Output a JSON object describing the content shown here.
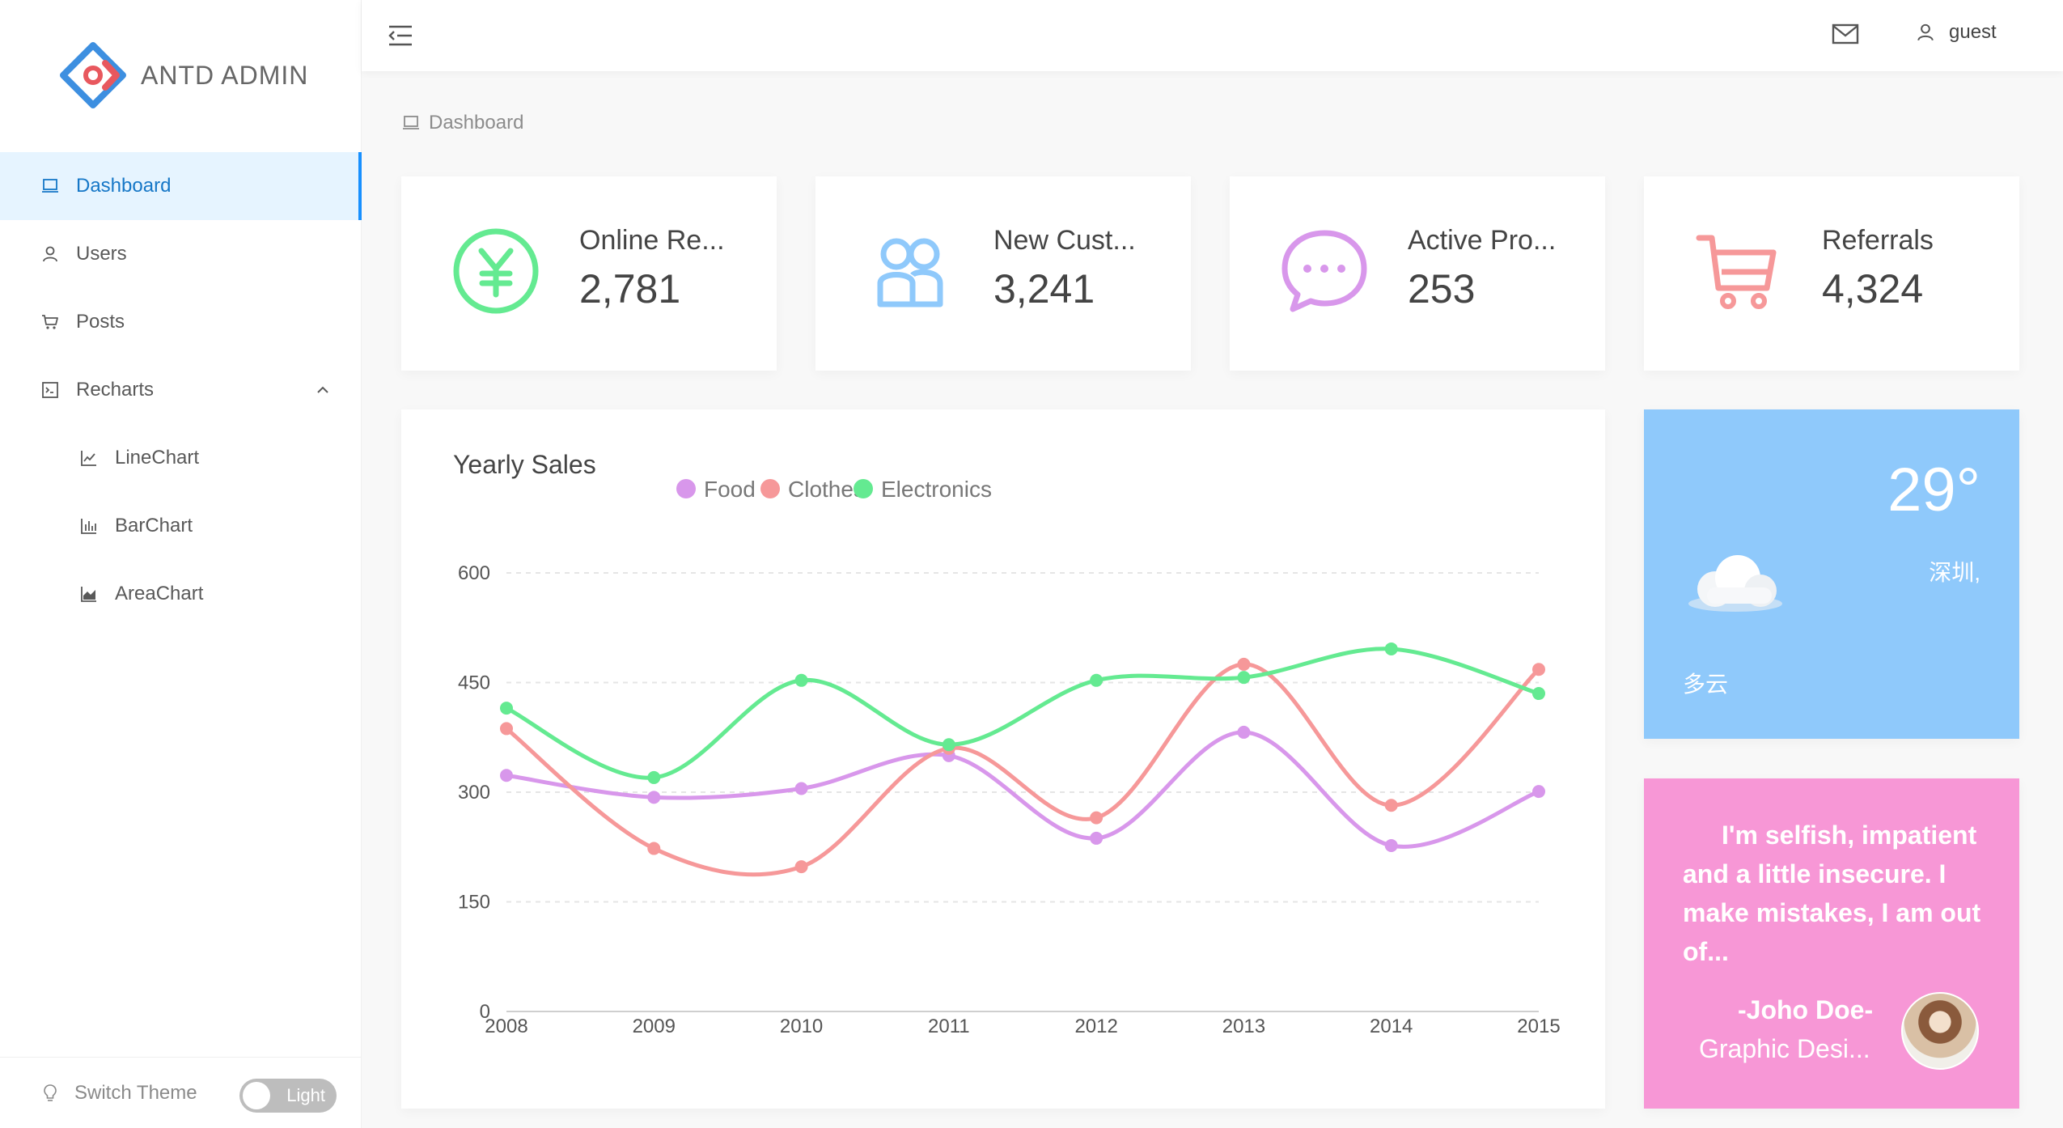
{
  "app": {
    "logo_text": "ANTD ADMIN"
  },
  "sidebar": {
    "items": [
      {
        "label": "Dashboard",
        "icon": "laptop-icon",
        "active": true
      },
      {
        "label": "Users",
        "icon": "user-icon"
      },
      {
        "label": "Posts",
        "icon": "shopping-cart-icon"
      },
      {
        "label": "Recharts",
        "icon": "code-icon",
        "expanded": true
      },
      {
        "label": "LineChart",
        "icon": "line-chart-icon"
      },
      {
        "label": "BarChart",
        "icon": "bar-chart-icon"
      },
      {
        "label": "AreaChart",
        "icon": "area-chart-icon"
      }
    ],
    "switch_theme_label": "Switch Theme",
    "theme_value": "Light"
  },
  "header": {
    "user_name": "guest"
  },
  "breadcrumb": {
    "current": "Dashboard"
  },
  "numbers": [
    {
      "title": "Online Re...",
      "value": "2,781",
      "icon": "pay-circle-icon",
      "color": "#64ea91"
    },
    {
      "title": "New Cust...",
      "value": "3,241",
      "icon": "team-icon",
      "color": "#8fc9fb"
    },
    {
      "title": "Active Pro...",
      "value": "253",
      "icon": "message-icon",
      "color": "#d897eb"
    },
    {
      "title": "Referrals",
      "value": "4,324",
      "icon": "shopping-cart-icon",
      "color": "#f69899"
    }
  ],
  "sales": {
    "title": "Yearly Sales"
  },
  "chart_data": {
    "type": "line",
    "x": [
      "2008",
      "2009",
      "2010",
      "2011",
      "2012",
      "2013",
      "2014",
      "2015"
    ],
    "ylim": [
      0,
      600
    ],
    "yticks": [
      "0",
      "150",
      "300",
      "450",
      "600"
    ],
    "grid": true,
    "legend_position": "top-right",
    "series": [
      {
        "name": "Food",
        "color": "#d897eb",
        "values": [
          323,
          293,
          305,
          350,
          237,
          382,
          227,
          301
        ]
      },
      {
        "name": "Clothes",
        "color": "#f69899",
        "values": [
          387,
          223,
          198,
          360,
          265,
          475,
          282,
          468
        ]
      },
      {
        "name": "Electronics",
        "color": "#64ea91",
        "values": [
          415,
          320,
          453,
          365,
          453,
          457,
          496,
          435
        ]
      }
    ]
  },
  "weather": {
    "temperature": "29°",
    "city": "深圳,",
    "condition": "多云",
    "icon": "cloud-icon"
  },
  "quote": {
    "text": "I'm selfish, impatient and a little insecure. I make mistakes, I am out of...",
    "name": "-Joho Doe-",
    "title": "Graphic Desi..."
  },
  "colors": {
    "accent": "#1890ff",
    "weather_bg": "#8fc9fb",
    "quote_bg": "#f797d6"
  }
}
